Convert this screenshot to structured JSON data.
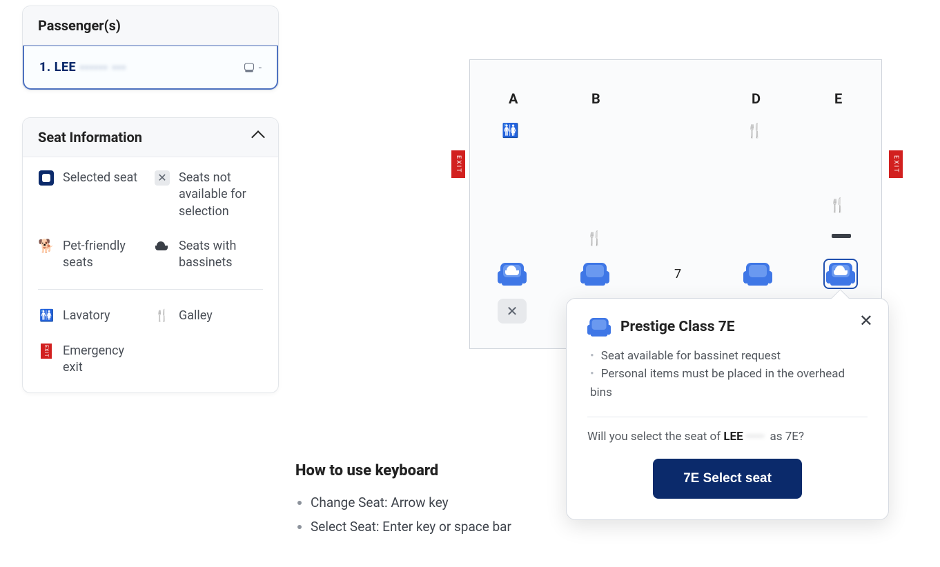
{
  "passengers": {
    "header": "Passenger(s)",
    "row1_prefix": "1. LEE",
    "row1_masked": "······ ···",
    "seat_placeholder": "-"
  },
  "seatinfo": {
    "header": "Seat Information",
    "legend": {
      "selected": "Selected seat",
      "unavailable": "Seats not available for selection",
      "pet": "Pet-friendly seats",
      "bassinet": "Seats with bassinets",
      "lavatory": "Lavatory",
      "galley": "Galley",
      "exit": "Emergency exit"
    }
  },
  "map": {
    "cols": {
      "A": "A",
      "B": "B",
      "D": "D",
      "E": "E"
    },
    "row7": "7",
    "exit_label": "EXIT"
  },
  "popover": {
    "title": "Prestige Class 7E",
    "bullets": [
      "Seat available for bassinet request",
      "Personal items must be placed in the overhead bins"
    ],
    "question_pre": "Will you select the seat of ",
    "question_name": "LEE",
    "question_post": " as 7E?",
    "button": "7E Select seat"
  },
  "kb": {
    "title": "How to use keyboard",
    "items": [
      "Change Seat: Arrow key",
      "Select Seat: Enter key or space bar"
    ]
  }
}
